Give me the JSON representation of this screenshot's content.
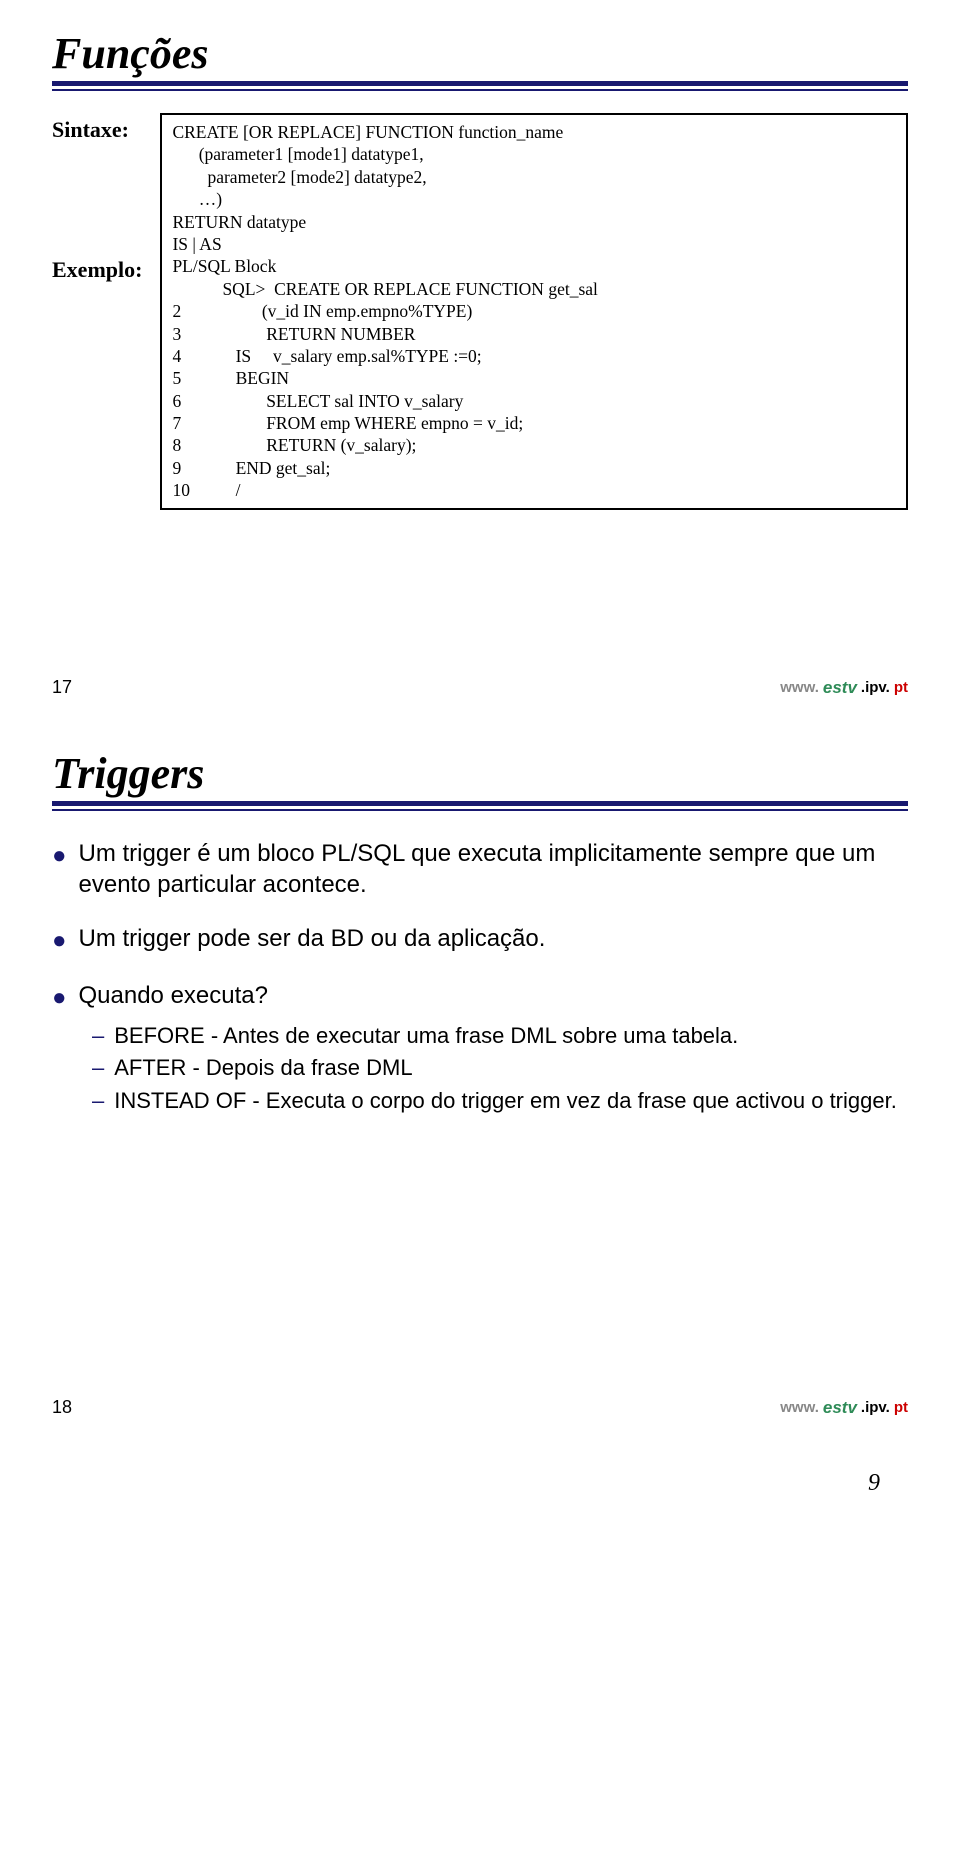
{
  "slide1": {
    "title": "Funções",
    "labelSintaxe": "Sintaxe:",
    "labelExemplo": "Exemplo:",
    "syntaxLines": [
      "CREATE [OR REPLACE] FUNCTION function_name",
      "      (parameter1 [mode1] datatype1,",
      "        parameter2 [mode2] datatype2,",
      "      …)",
      "RETURN datatype",
      "IS | AS",
      "PL/SQL Block"
    ],
    "exampleNums": [
      "",
      "2",
      "3",
      "4",
      "5",
      "6",
      "7",
      "8",
      "9",
      "10"
    ],
    "exampleBodies": [
      "SQL>  CREATE OR REPLACE FUNCTION get_sal",
      "         (v_id IN emp.empno%TYPE)",
      "          RETURN NUMBER",
      "   IS     v_salary emp.sal%TYPE :=0;",
      "   BEGIN",
      "          SELECT sal INTO v_salary",
      "          FROM emp WHERE empno = v_id;",
      "          RETURN (v_salary);",
      "   END get_sal;",
      "   /"
    ],
    "slideNumber": "17",
    "logoWww": "www.",
    "logoEstv": "estv",
    "logoIpv": ".ipv.",
    "logoPt": "pt"
  },
  "slide2": {
    "title": "Triggers",
    "bullet1": "Um trigger é um bloco PL/SQL que executa implicitamente sempre que um evento particular acontece.",
    "bullet2": "Um trigger pode ser da BD ou da aplicação.",
    "bullet3": "Quando executa?",
    "sub1": "BEFORE - Antes de executar uma frase DML sobre uma tabela.",
    "sub2": "AFTER - Depois da frase DML",
    "sub3": "INSTEAD OF - Executa o corpo do trigger em vez da frase que activou o trigger.",
    "slideNumber": "18",
    "logoWww": "www.",
    "logoEstv": "estv",
    "logoIpv": ".ipv.",
    "logoPt": "pt"
  },
  "pageNumber": "9"
}
